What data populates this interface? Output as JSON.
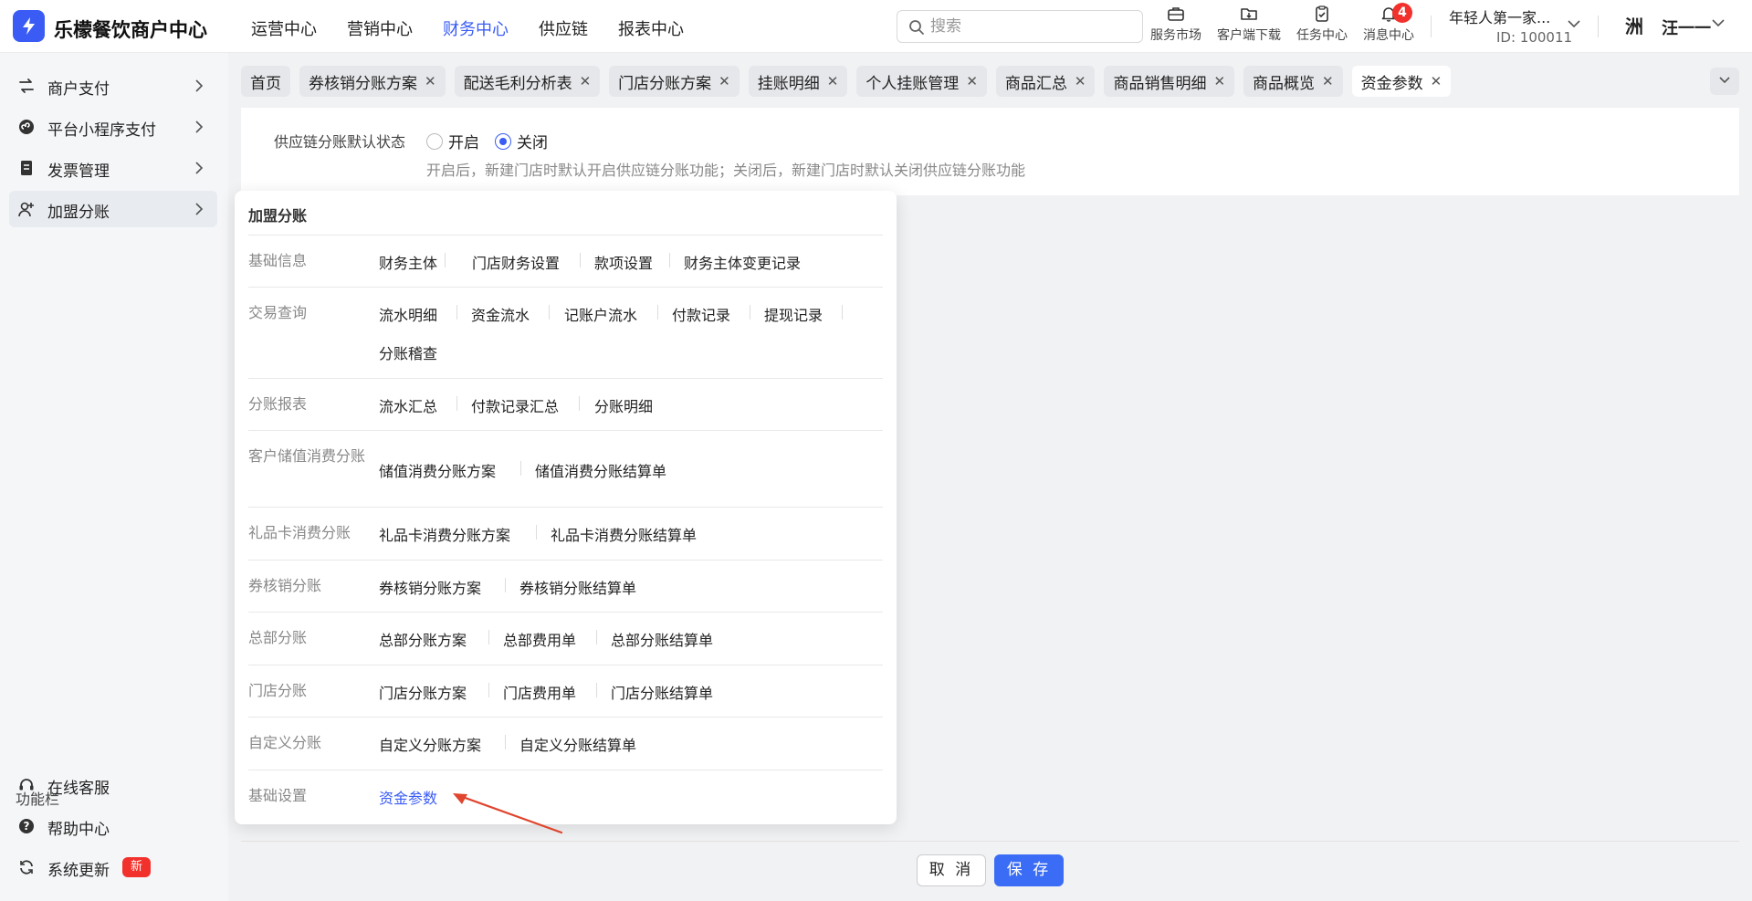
{
  "brand": {
    "name": "乐檬餐饮商户中心",
    "accent": "#3a5cf5"
  },
  "topnav": [
    "运营中心",
    "营销中心",
    "财务中心",
    "供应链",
    "报表中心"
  ],
  "topnav_active_index": 2,
  "search": {
    "placeholder": "搜索"
  },
  "toolbar": {
    "service_market": "服务市场",
    "client_download": "客户端下载",
    "task_center": "任务中心",
    "message_center": "消息中心",
    "message_count": "4"
  },
  "account": {
    "name": "年轻人第一家...",
    "id": "ID: 100011"
  },
  "user": {
    "avatar_text": "洲",
    "name": "汪一一"
  },
  "sidebar": {
    "items": [
      {
        "label": "商户支付",
        "icon": "exchange-icon"
      },
      {
        "label": "平台小程序支付",
        "icon": "mini-program-icon"
      },
      {
        "label": "发票管理",
        "icon": "invoice-icon"
      },
      {
        "label": "加盟分账",
        "icon": "user-add-icon",
        "selected": true
      }
    ],
    "func_title": "功能栏",
    "func_items": [
      {
        "label": "在线客服",
        "icon": "headset-icon"
      },
      {
        "label": "帮助中心",
        "icon": "help-icon"
      },
      {
        "label": "系统更新",
        "icon": "refresh-icon",
        "badge": "新"
      }
    ]
  },
  "tabs": [
    {
      "label": "首页",
      "closable": false
    },
    {
      "label": "券核销分账方案",
      "closable": true
    },
    {
      "label": "配送毛利分析表",
      "closable": true
    },
    {
      "label": "门店分账方案",
      "closable": true
    },
    {
      "label": "挂账明细",
      "closable": true
    },
    {
      "label": "个人挂账管理",
      "closable": true
    },
    {
      "label": "商品汇总",
      "closable": true
    },
    {
      "label": "商品销售明细",
      "closable": true
    },
    {
      "label": "商品概览",
      "closable": true
    },
    {
      "label": "资金参数",
      "closable": true,
      "active": true
    }
  ],
  "setting": {
    "label": "供应链分账默认状态",
    "option_on": "开启",
    "option_off": "关闭",
    "selected": "关闭",
    "hint": "开启后，新建门店时默认开启供应链分账功能；关闭后，新建门店时默认关闭供应链分账功能"
  },
  "buttons": {
    "cancel": "取 消",
    "save": "保 存"
  },
  "panel": {
    "title": "加盟分账",
    "rows": [
      {
        "category": "基础信息",
        "links": [
          "财务主体",
          "门店财务设置",
          "款项设置",
          "财务主体变更记录"
        ]
      },
      {
        "category": "交易查询",
        "links": [
          "流水明细",
          "资金流水",
          "记账户流水",
          "付款记录",
          "提现记录",
          "分账稽查"
        ]
      },
      {
        "category": "分账报表",
        "links": [
          "流水汇总",
          "付款记录汇总",
          "分账明细"
        ]
      },
      {
        "category": "客户储值消费分账",
        "links": [
          "储值消费分账方案",
          "储值消费分账结算单"
        ]
      },
      {
        "category": "礼品卡消费分账",
        "links": [
          "礼品卡消费分账方案",
          "礼品卡消费分账结算单"
        ]
      },
      {
        "category": "券核销分账",
        "links": [
          "券核销分账方案",
          "券核销分账结算单"
        ]
      },
      {
        "category": "总部分账",
        "links": [
          "总部分账方案",
          "总部费用单",
          "总部分账结算单"
        ]
      },
      {
        "category": "门店分账",
        "links": [
          "门店分账方案",
          "门店费用单",
          "门店分账结算单"
        ]
      },
      {
        "category": "自定义分账",
        "links": [
          "自定义分账方案",
          "自定义分账结算单"
        ]
      },
      {
        "category": "基础设置",
        "links": [
          "资金参数"
        ],
        "highlight": "资金参数"
      }
    ]
  },
  "colors": {
    "primary": "#3a5cf5",
    "badge_red": "#f2312c",
    "annotation_arrow": "#e0452e"
  }
}
